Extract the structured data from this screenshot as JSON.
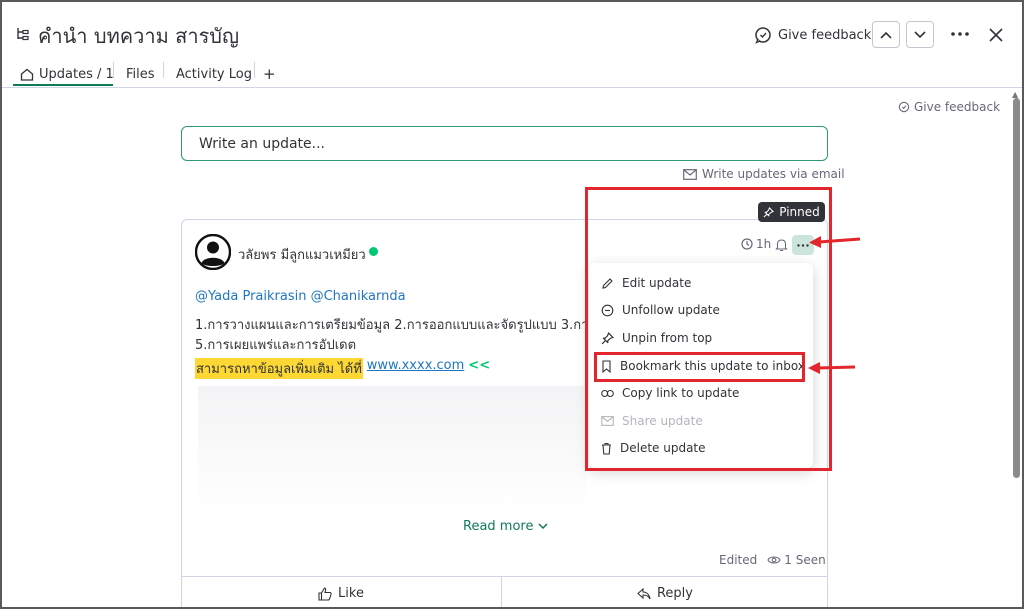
{
  "header": {
    "title": "คำนำ บทความ สารบัญ",
    "give_feedback": "Give feedback"
  },
  "tabs": [
    {
      "label": "Updates / 1"
    },
    {
      "label": "Files"
    },
    {
      "label": "Activity Log"
    },
    {
      "label": "+"
    }
  ],
  "side": {
    "give_feedback": "Give feedback"
  },
  "composer": {
    "placeholder": "Write an update...",
    "email_link": "Write updates via email"
  },
  "post": {
    "pinned_label": "Pinned",
    "author": "วลัยพร มีลูกแมวเหมียว",
    "time": "1h",
    "mentions": "@Yada Praikrasin @Chanikarnda",
    "line1": "1.การวางแผนและการเตรียมข้อมูล 2.การออกแบบและจัดรูปแบบ 3.การเ",
    "line2": "5.การเผยแพร่และการอัปเดต",
    "highlight_text": "สามารถหาข้อมูลเพิ่มเติม ได้ที่",
    "link_text": "www.xxxx.com",
    "arrows": "<<",
    "read_more": "Read more",
    "edited": "Edited",
    "seen": "1 Seen",
    "like": "Like",
    "reply": "Reply"
  },
  "menu": {
    "items": [
      {
        "label": "Edit update",
        "icon": "pencil-icon"
      },
      {
        "label": "Unfollow update",
        "icon": "chat-bubble-icon"
      },
      {
        "label": "Unpin from top",
        "icon": "pin-icon"
      },
      {
        "label": "Bookmark this update to inbox",
        "icon": "bookmark-icon"
      },
      {
        "label": "Copy link to update",
        "icon": "link-icon"
      },
      {
        "label": "Share update",
        "icon": "mail-icon",
        "disabled": true
      },
      {
        "label": "Delete update",
        "icon": "trash-icon"
      }
    ]
  },
  "colors": {
    "accent": "#0f7a5a",
    "annotation": "#e3262b",
    "highlight": "#fdd835"
  }
}
